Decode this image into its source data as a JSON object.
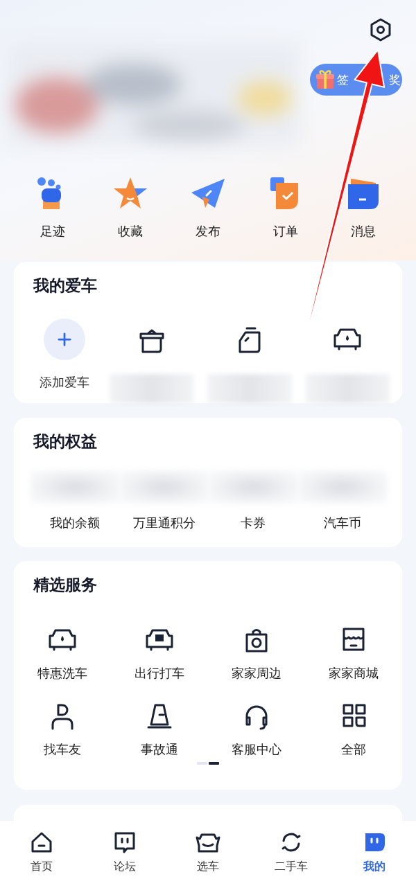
{
  "header": {
    "sign_in_button": {
      "parts": [
        "签",
        "奖"
      ]
    }
  },
  "quick_links": [
    {
      "label": "足迹"
    },
    {
      "label": "收藏"
    },
    {
      "label": "发布"
    },
    {
      "label": "订单"
    },
    {
      "label": "消息"
    }
  ],
  "my_cars": {
    "title": "我的爱车",
    "add_label": "添加爱车"
  },
  "benefits": {
    "title": "我的权益",
    "items": [
      {
        "label": "我的余额"
      },
      {
        "label": "万里通积分"
      },
      {
        "label": "卡券"
      },
      {
        "label": "汽车币"
      }
    ]
  },
  "services": {
    "title": "精选服务",
    "items": [
      {
        "label": "特惠洗车"
      },
      {
        "label": "出行打车"
      },
      {
        "label": "家家周边"
      },
      {
        "label": "家家商城"
      },
      {
        "label": "找车友"
      },
      {
        "label": "事故通"
      },
      {
        "label": "客服中心"
      },
      {
        "label": "全部"
      }
    ],
    "pager": [
      {
        "selected": false
      },
      {
        "selected": true
      }
    ]
  },
  "bottom_nav": [
    {
      "label": "首页",
      "selected": false
    },
    {
      "label": "论坛",
      "selected": false
    },
    {
      "label": "选车",
      "selected": false
    },
    {
      "label": "二手车",
      "selected": false
    },
    {
      "label": "我的",
      "selected": true
    }
  ]
}
